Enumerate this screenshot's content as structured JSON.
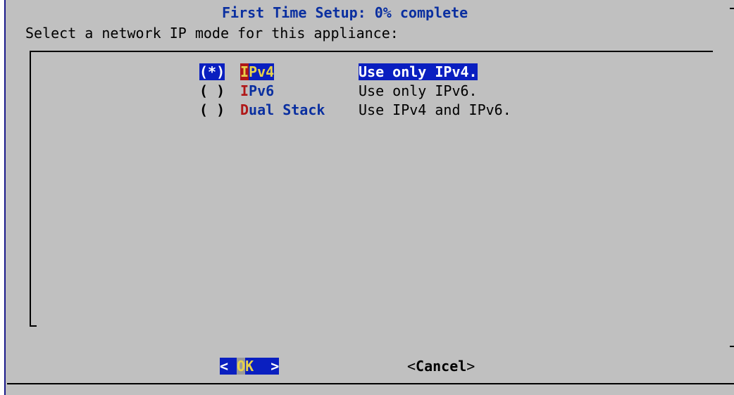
{
  "dialog": {
    "title": "First Time Setup: 0% complete",
    "prompt": "Select a network IP mode for this appliance:"
  },
  "options": [
    {
      "radio": "(*)",
      "hotkey": "I",
      "rest": "Pv4",
      "description": "Use only IPv4.",
      "selected": true
    },
    {
      "radio": "( )",
      "hotkey": "I",
      "rest": "Pv6",
      "description": "Use only IPv6.",
      "selected": false
    },
    {
      "radio": "( )",
      "hotkey": "D",
      "rest": "ual Stack",
      "description": "Use IPv4 and IPv6.",
      "selected": false
    }
  ],
  "buttons": {
    "ok": {
      "left_bracket": "< ",
      "hotkey": "O",
      "rest": "K ",
      "right_bracket": " >"
    },
    "cancel": {
      "open": "<",
      "label": "Cancel",
      "close": ">"
    }
  },
  "colors": {
    "background": "#c0c0c0",
    "title": "#0a2fa0",
    "selection": "#0a1fc0",
    "hotkey": "#b01818",
    "selected_tag": "#e8d24a"
  }
}
